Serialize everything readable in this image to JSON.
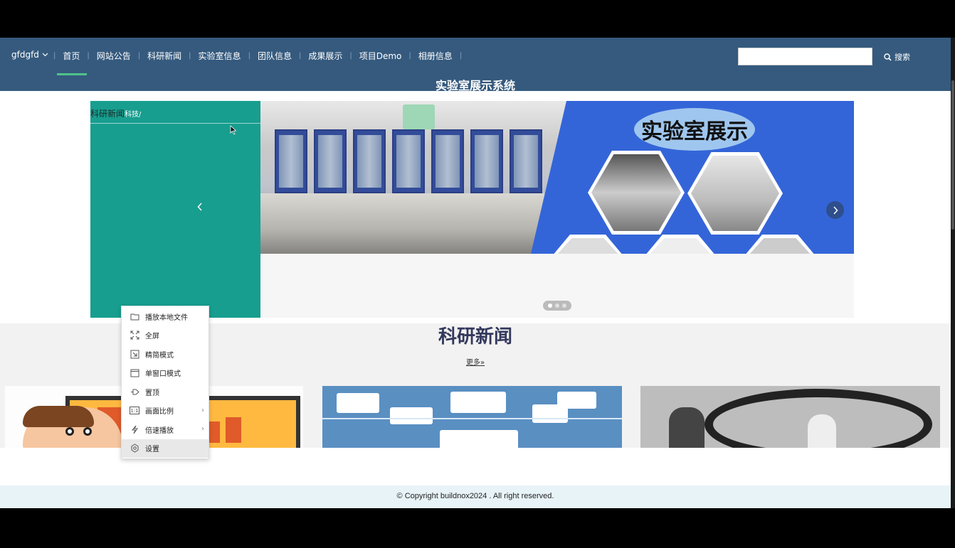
{
  "nav": {
    "user": "gfdgfd",
    "items": [
      {
        "label": "首页"
      },
      {
        "label": "网站公告"
      },
      {
        "label": "科研新闻"
      },
      {
        "label": "实验室信息"
      },
      {
        "label": "团队信息"
      },
      {
        "label": "成果展示"
      },
      {
        "label": "项目Demo"
      },
      {
        "label": "相册信息"
      }
    ],
    "active_index": 0,
    "search_value": "",
    "search_label": "搜索"
  },
  "site_title": "实验室展示系统",
  "banner": {
    "panel_title": "科研新闻",
    "panel_sub": "科技/",
    "slide_caption": "实验室展示",
    "slide_count": 3,
    "active_slide": 0
  },
  "section": {
    "title": "科研新闻",
    "more": "更多"
  },
  "footer": {
    "copyright": "© Copyright buildnox2024 . All right reserved."
  },
  "context_menu": {
    "items": [
      {
        "label": "播放本地文件",
        "icon": "folder-icon"
      },
      {
        "label": "全屏",
        "icon": "fullscreen-icon"
      },
      {
        "label": "精简模式",
        "icon": "compact-mode-icon"
      },
      {
        "label": "单窗口模式",
        "icon": "window-icon"
      },
      {
        "label": "置顶",
        "icon": "pin-icon"
      },
      {
        "label": "画面比例",
        "icon": "aspect-ratio-icon",
        "submenu": true,
        "icon_text": "1:1"
      },
      {
        "label": "倍速播放",
        "icon": "speed-icon",
        "submenu": true
      },
      {
        "label": "设置",
        "icon": "settings-icon"
      }
    ],
    "hovered_index": 7
  },
  "colors": {
    "nav_bg": "#355a7e",
    "active_underline": "#4fc38a",
    "panel_teal": "#179e8f",
    "slide_blue": "#3465d8",
    "section_title": "#33385c"
  }
}
